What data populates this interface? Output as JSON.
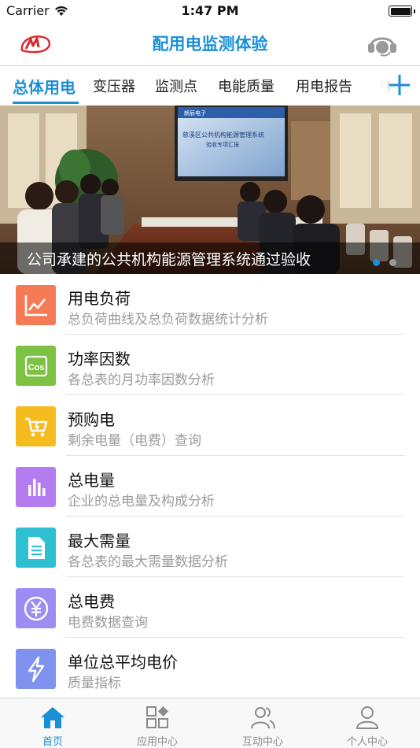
{
  "status_bar": {
    "carrier": "Carrier",
    "time": "1:47 PM"
  },
  "nav": {
    "title": "配用电监测体验",
    "logo_icon": "app-logo-icon",
    "service_icon": "headset-icon"
  },
  "tabs": {
    "items": [
      {
        "label": "总体用电",
        "active": true
      },
      {
        "label": "变压器"
      },
      {
        "label": "监测点"
      },
      {
        "label": "电能质量"
      },
      {
        "label": "用电报告"
      }
    ],
    "overflow": "电",
    "add_icon": "plus-icon"
  },
  "banner": {
    "caption": "公司承建的公共机构能源管理系统通过验收",
    "screen_lines": [
      "慈溪区公共机构能源管理系统",
      "验收专项汇报"
    ],
    "screen_header": "朗辰电子",
    "dots": 2,
    "active_dot": 0
  },
  "list": [
    {
      "title": "用电负荷",
      "subtitle": "总负荷曲线及总负荷数据统计分析",
      "icon": "line-chart-icon",
      "color": "#f47b55"
    },
    {
      "title": "功率因数",
      "subtitle": "各总表的月功率因数分析",
      "icon": "cos-icon",
      "icon_text": "Cos",
      "color": "#7dc243"
    },
    {
      "title": "预购电",
      "subtitle": "剩余电量（电费）查询",
      "icon": "prepaid-cart-icon",
      "color": "#f6bb1e"
    },
    {
      "title": "总电量",
      "subtitle": "企业的总电量及构成分析",
      "icon": "bar-chart-icon",
      "color": "#b57cf0"
    },
    {
      "title": "最大需量",
      "subtitle": "各总表的最大需量数据分析",
      "icon": "document-icon",
      "color": "#2ebfd0"
    },
    {
      "title": "总电费",
      "subtitle": "电费数据查询",
      "icon": "yen-icon",
      "color": "#9b8df2"
    },
    {
      "title": "单位总平均电价",
      "subtitle": "质量指标",
      "icon": "lightning-icon",
      "color": "#7f92f0"
    }
  ],
  "tabbar": [
    {
      "label": "首页",
      "icon": "home-icon",
      "active": true
    },
    {
      "label": "应用中心",
      "icon": "app-grid-icon"
    },
    {
      "label": "互动中心",
      "icon": "users-icon"
    },
    {
      "label": "个人中心",
      "icon": "person-icon"
    }
  ],
  "colors": {
    "accent": "#1a8fd6",
    "text": "#111111",
    "subtext": "#9b9b9b"
  }
}
